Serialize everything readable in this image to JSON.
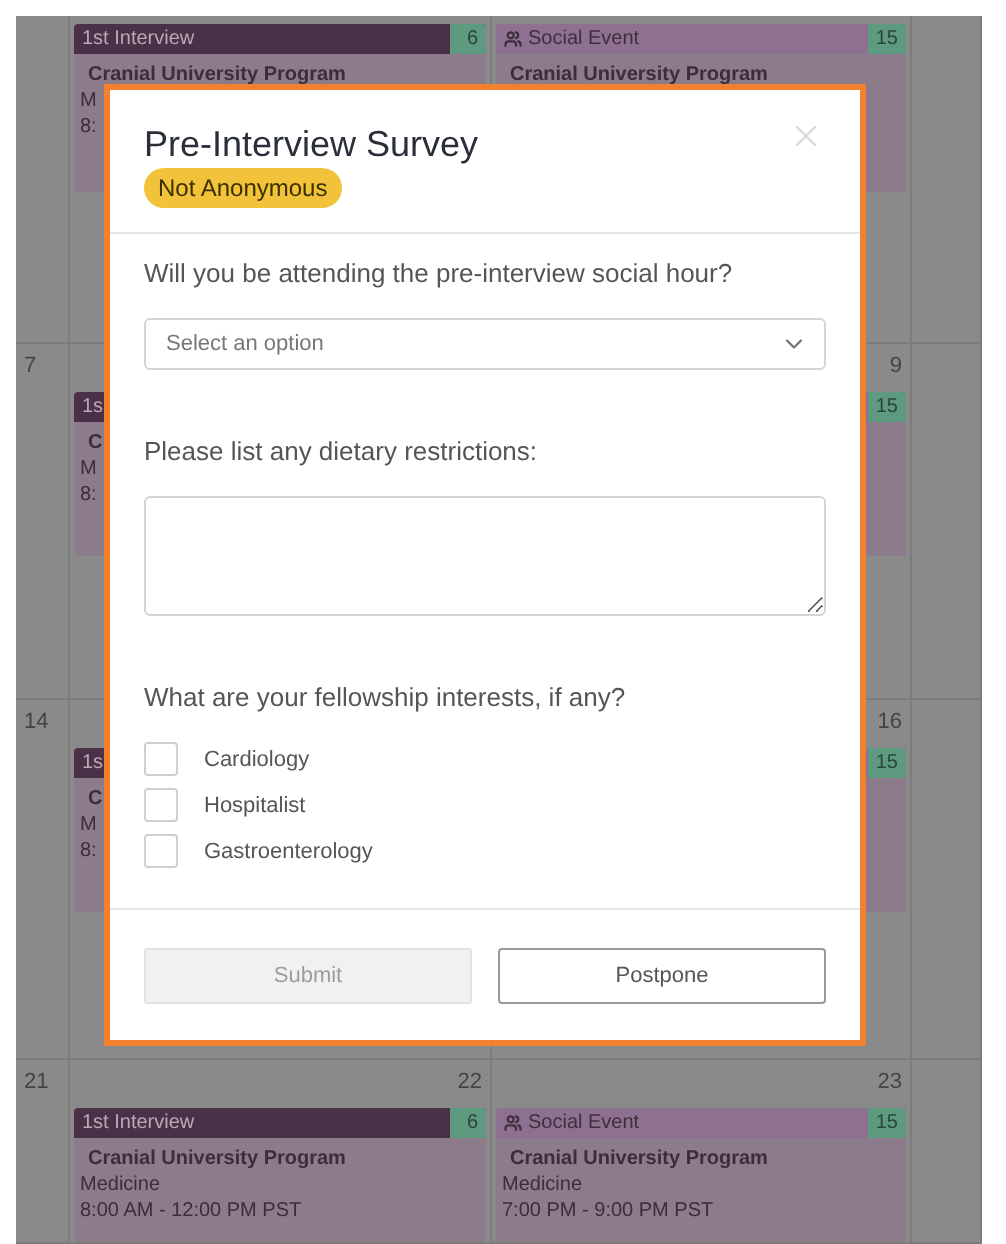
{
  "calendar": {
    "weeks": [
      {
        "cells": [
          {},
          {
            "event": {
              "kind": "interview",
              "title": "1st Interview",
              "count": "6",
              "lines": [
                "Cranial University Program",
                "M",
                "8:"
              ]
            }
          },
          {
            "event": {
              "kind": "social",
              "title": "Social Event",
              "count": "15",
              "lines": [
                "Cranial University Program"
              ]
            }
          },
          {}
        ]
      },
      {
        "cells": [
          {
            "day": "7"
          },
          {
            "event": {
              "kind": "interview",
              "title": "1s",
              "lines": [
                "C",
                "M",
                "8:"
              ]
            }
          },
          {
            "day": "9",
            "event": {
              "kind": "social",
              "count": "15"
            }
          },
          {}
        ]
      },
      {
        "cells": [
          {
            "day": "14"
          },
          {
            "event": {
              "kind": "interview",
              "title": "1s",
              "lines": [
                "C",
                "M",
                "8:"
              ]
            }
          },
          {
            "day": "16",
            "event": {
              "kind": "social",
              "count": "15"
            }
          },
          {}
        ]
      },
      {
        "cells": [
          {
            "day": "21"
          },
          {
            "day": "22",
            "event": {
              "kind": "interview",
              "title": "1st Interview",
              "count": "6",
              "lines": [
                "Cranial University Program",
                "Medicine",
                "8:00 AM - 12:00 PM PST"
              ]
            }
          },
          {
            "day": "23",
            "event": {
              "kind": "social",
              "title": "Social Event",
              "count": "15",
              "lines": [
                "Cranial University Program",
                "Medicine",
                "7:00 PM - 9:00 PM PST"
              ]
            }
          },
          {}
        ]
      }
    ]
  },
  "modal": {
    "title": "Pre-Interview Survey",
    "badge": "Not Anonymous",
    "questions": [
      {
        "kind": "select",
        "label": "Will you be attending the pre-interview social hour?",
        "placeholder": "Select an option"
      },
      {
        "kind": "textarea",
        "label": "Please list any dietary restrictions:"
      },
      {
        "kind": "checkboxes",
        "label": "What are your fellowship interests, if any?",
        "options": [
          {
            "label": "Cardiology",
            "checked": false
          },
          {
            "label": "Hospitalist",
            "checked": false
          },
          {
            "label": "Gastroenterology",
            "checked": false
          }
        ]
      }
    ],
    "buttons": [
      {
        "label": "Submit",
        "disabled": true
      },
      {
        "label": "Postpone",
        "disabled": false
      }
    ]
  }
}
